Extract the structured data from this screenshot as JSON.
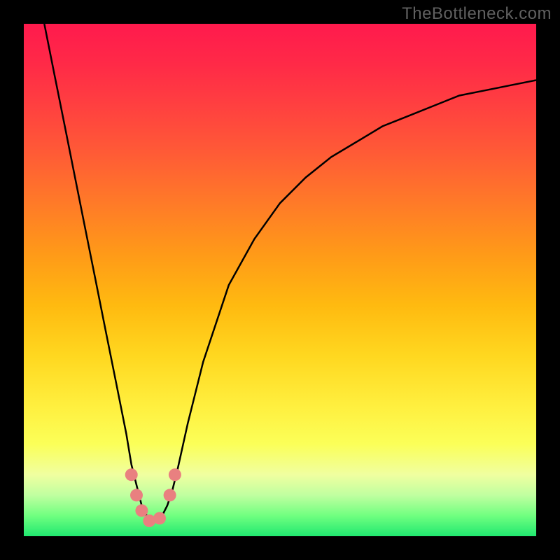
{
  "watermark": "TheBottleneck.com",
  "colors": {
    "frame": "#000000",
    "curve": "#000000",
    "marker": "#e98080",
    "gradient_top": "#ff1a4d",
    "gradient_bottom": "#20e870"
  },
  "chart_data": {
    "type": "line",
    "title": "",
    "xlabel": "",
    "ylabel": "",
    "xlim": [
      0,
      100
    ],
    "ylim": [
      0,
      100
    ],
    "grid": false,
    "legend": false,
    "series": [
      {
        "name": "bottleneck-curve",
        "x": [
          4,
          6,
          8,
          10,
          12,
          14,
          16,
          18,
          20,
          21,
          22,
          23,
          24,
          25,
          26,
          27,
          28,
          29,
          30,
          32,
          35,
          40,
          45,
          50,
          55,
          60,
          65,
          70,
          75,
          80,
          85,
          90,
          95,
          100
        ],
        "values": [
          100,
          90,
          80,
          70,
          60,
          50,
          40,
          30,
          20,
          14,
          10,
          6,
          4,
          3,
          3,
          4,
          6,
          9,
          13,
          22,
          34,
          49,
          58,
          65,
          70,
          74,
          77,
          80,
          82,
          84,
          86,
          87,
          88,
          89
        ]
      }
    ],
    "markers": [
      {
        "x": 21,
        "y": 12
      },
      {
        "x": 22,
        "y": 8
      },
      {
        "x": 23,
        "y": 5
      },
      {
        "x": 24.5,
        "y": 3
      },
      {
        "x": 26.5,
        "y": 3.5
      },
      {
        "x": 28.5,
        "y": 8
      },
      {
        "x": 29.5,
        "y": 12
      }
    ],
    "marker_radius_px": 9
  }
}
